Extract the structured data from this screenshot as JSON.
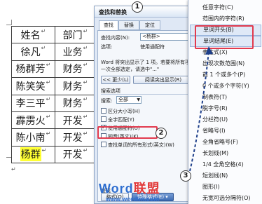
{
  "document": {
    "table": {
      "rows": [
        {
          "name": "姓名",
          "dept": "部门",
          "highlight": false
        },
        {
          "name": "徐凡",
          "dept": "业务",
          "highlight": false
        },
        {
          "name": "杨群芳",
          "dept": "财务",
          "highlight": false
        },
        {
          "name": "陈笑笑",
          "dept": "财务",
          "highlight": false
        },
        {
          "name": "李三平",
          "dept": "财务",
          "highlight": false
        },
        {
          "name": "霹雳火",
          "dept": "开发",
          "highlight": false
        },
        {
          "name": "陈小南",
          "dept": "开发",
          "highlight": false
        },
        {
          "name": "杨群",
          "dept": "开发",
          "highlight": true
        }
      ],
      "highlight_color": "#ffff33"
    },
    "cell_mark": "↵",
    "para_mark": "↵"
  },
  "dialog": {
    "title": "查找和替换",
    "tabs": [
      "查找",
      "替换",
      "定位"
    ],
    "find_label": "查找内容(N):",
    "find_value": "<杨群>",
    "options_label": "选项:",
    "options_value": "使用通配符",
    "message": "Word 将突出显示了 1 项。若要将所有项一次全部选定，请选中\"...\"",
    "less_button": "<< 更少(L)",
    "reading_highlight_button": "阅读突出显示(R)",
    "search_options_label": "搜索选项",
    "search_label": "搜索:",
    "search_value": "全部",
    "checkboxes": [
      {
        "label": "区分大小写(H)",
        "checked": false
      },
      {
        "label": "全字匹配(Y)",
        "checked": false
      },
      {
        "label": "使用通配符(U)",
        "checked": true
      },
      {
        "label": "同音(英文)(K)",
        "checked": false
      },
      {
        "label": "查找单词的所有形式(英文)(W)",
        "checked": false
      }
    ],
    "find_section_label": "查找",
    "format_button": "格式(O)",
    "special_button": "特殊格式(E)"
  },
  "menu": {
    "items": [
      {
        "label": "任意字符(C)",
        "selected": false
      },
      {
        "label": "范围内的字符(R)",
        "selected": false
      },
      {
        "label": "单词开头(B)",
        "selected": true
      },
      {
        "label": "单词结尾(E)",
        "selected": true
      },
      {
        "label": "表达式(X)",
        "selected": false
      },
      {
        "label": "出现次数范围(N)",
        "selected": false
      },
      {
        "label": "前 1 个或多个(P)",
        "selected": false
      },
      {
        "label": "0 个或多个字符(Y)",
        "selected": false
      },
      {
        "label": "制表符(T)",
        "selected": false
      },
      {
        "label": "脱字号(R)",
        "selected": false
      },
      {
        "label": "分栏符(U)",
        "selected": false
      },
      {
        "label": "省略号(I)",
        "selected": false
      },
      {
        "label": "全角省略号(F)",
        "selected": false
      },
      {
        "label": "长划线(M)",
        "selected": false
      },
      {
        "label": "1/4 全角空格(4)",
        "selected": false
      },
      {
        "label": "短划线(N)",
        "selected": false
      },
      {
        "label": "图形(I)",
        "selected": false
      },
      {
        "label": "无宽可选分隔符(O)",
        "selected": false
      }
    ]
  },
  "annotations": {
    "badges": [
      "1",
      "2",
      "3"
    ],
    "color": "#e23a4e"
  },
  "watermark": {
    "logo_pre": "Word",
    "logo_post": "联盟",
    "url": "www.wordlm.com"
  }
}
